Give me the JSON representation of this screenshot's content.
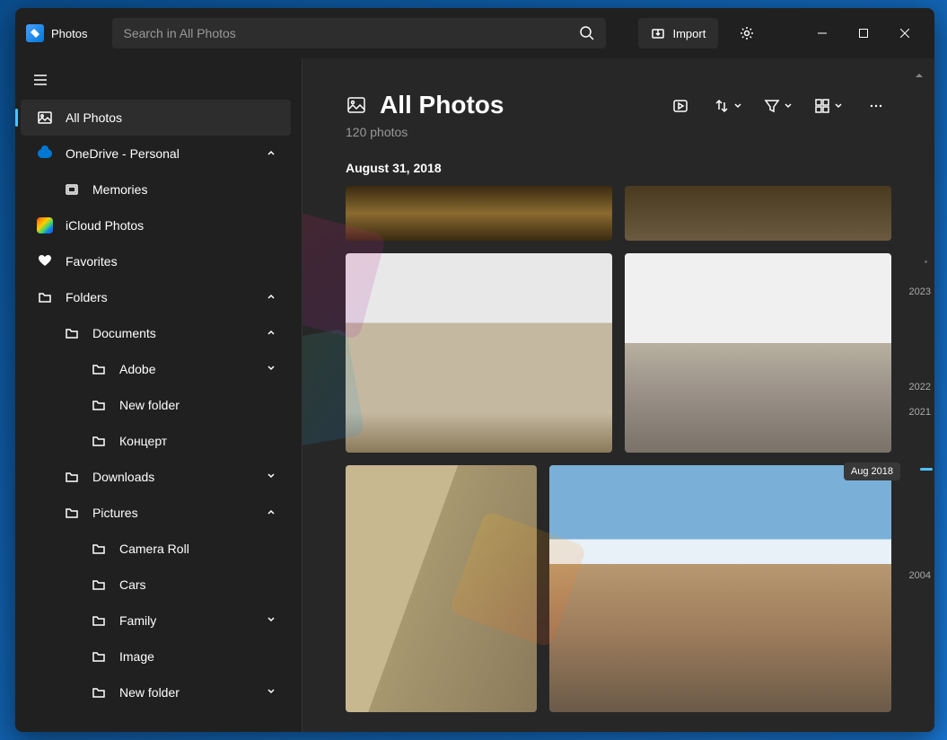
{
  "app": {
    "title": "Photos"
  },
  "search": {
    "placeholder": "Search in All Photos"
  },
  "import": {
    "label": "Import"
  },
  "sidebar": {
    "all_photos": "All Photos",
    "onedrive": "OneDrive - Personal",
    "memories": "Memories",
    "icloud": "iCloud Photos",
    "favorites": "Favorites",
    "folders": "Folders",
    "documents": "Documents",
    "adobe": "Adobe",
    "newfolder1": "New folder",
    "concert": "Концерт",
    "downloads": "Downloads",
    "pictures": "Pictures",
    "cameraroll": "Camera Roll",
    "cars": "Cars",
    "family": "Family",
    "image": "Image",
    "newfolder2": "New folder"
  },
  "page": {
    "title": "All Photos",
    "subtitle": "120 photos",
    "date_header": "August 31, 2018"
  },
  "timeline": {
    "y2023": "2023",
    "y2022": "2022",
    "y2021": "2021",
    "y2004": "2004",
    "badge": "Aug 2018"
  }
}
